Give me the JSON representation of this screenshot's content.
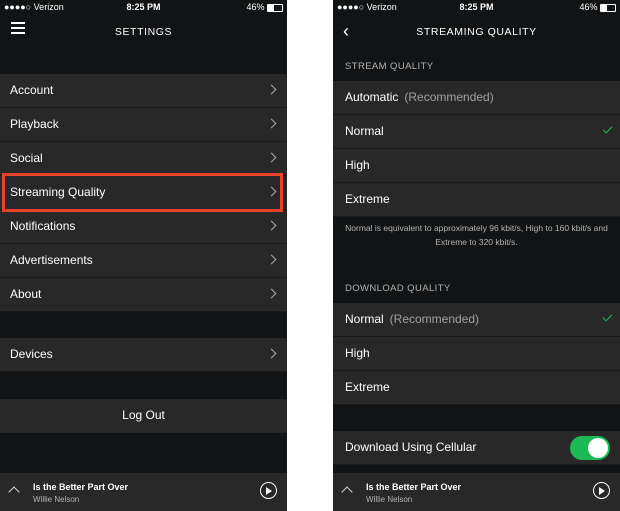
{
  "status_bar": {
    "carrier": "●●●●○ Verizon",
    "time": "8:25 PM",
    "battery": "46%"
  },
  "settings": {
    "title": "SETTINGS",
    "items": [
      {
        "label": "Account"
      },
      {
        "label": "Playback"
      },
      {
        "label": "Social"
      },
      {
        "label": "Streaming Quality"
      },
      {
        "label": "Notifications"
      },
      {
        "label": "Advertisements"
      },
      {
        "label": "About"
      }
    ],
    "devices_label": "Devices",
    "logout_label": "Log Out"
  },
  "streaming": {
    "title": "STREAMING QUALITY",
    "stream_header": "STREAM QUALITY",
    "stream_options": [
      {
        "label": "Automatic",
        "note": "(Recommended)",
        "selected": false
      },
      {
        "label": "Normal",
        "note": "",
        "selected": true
      },
      {
        "label": "High",
        "note": "",
        "selected": false
      },
      {
        "label": "Extreme",
        "note": "",
        "selected": false
      }
    ],
    "description": "Normal is equivalent to approximately 96 kbit/s, High to 160 kbit/s and Extreme to 320 kbit/s.",
    "download_header": "DOWNLOAD QUALITY",
    "download_options": [
      {
        "label": "Normal",
        "note": "(Recommended)",
        "selected": true
      },
      {
        "label": "High",
        "note": "",
        "selected": false
      },
      {
        "label": "Extreme",
        "note": "",
        "selected": false
      }
    ],
    "cellular_label": "Download Using Cellular",
    "cellular_enabled": true
  },
  "player": {
    "track": "Is the Better Part Over",
    "artist": "Willie Nelson"
  },
  "colors": {
    "accent": "#1db954",
    "highlight": "#e8432a",
    "background": "#121314",
    "row": "#282828"
  }
}
